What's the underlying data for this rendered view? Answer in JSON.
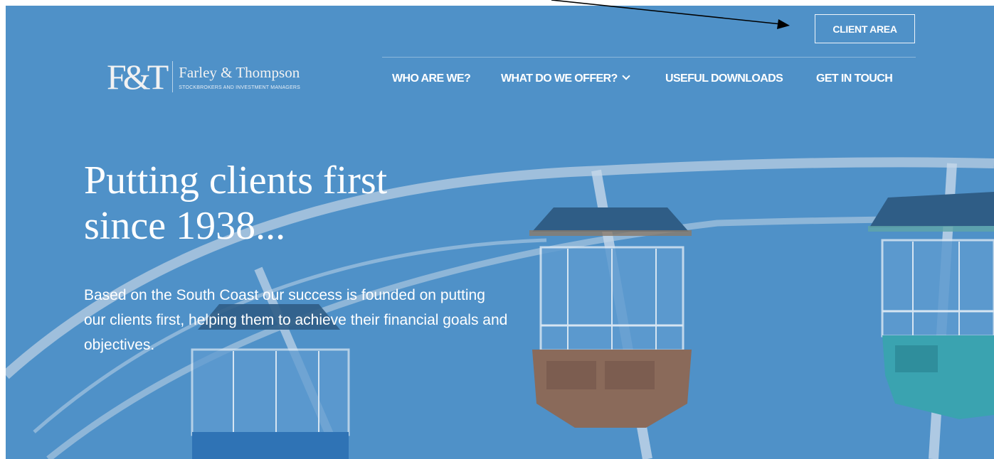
{
  "header": {
    "client_area_label": "CLIENT AREA",
    "logo": {
      "mark": "F&T",
      "name": "Farley & Thompson",
      "tagline": "STOCKBROKERS AND INVESTMENT MANAGERS"
    },
    "nav": [
      {
        "label": "WHO ARE WE?"
      },
      {
        "label": "WHAT DO WE OFFER?",
        "has_dropdown": true
      },
      {
        "label": "USEFUL DOWNLOADS"
      },
      {
        "label": "GET IN TOUCH"
      }
    ]
  },
  "hero": {
    "headline_line1": "Putting clients first",
    "headline_line2": "since 1938...",
    "subtext": "Based on the South Coast our success is founded on putting our clients first, helping them to achieve their financial goals and objectives.",
    "background_color": "#4f91c8"
  },
  "annotation": {
    "arrow_color": "#000000",
    "target": "client-area-button"
  },
  "icons": {
    "dropdown": "chevron-down-icon",
    "annotation_arrow": "arrow-icon"
  }
}
